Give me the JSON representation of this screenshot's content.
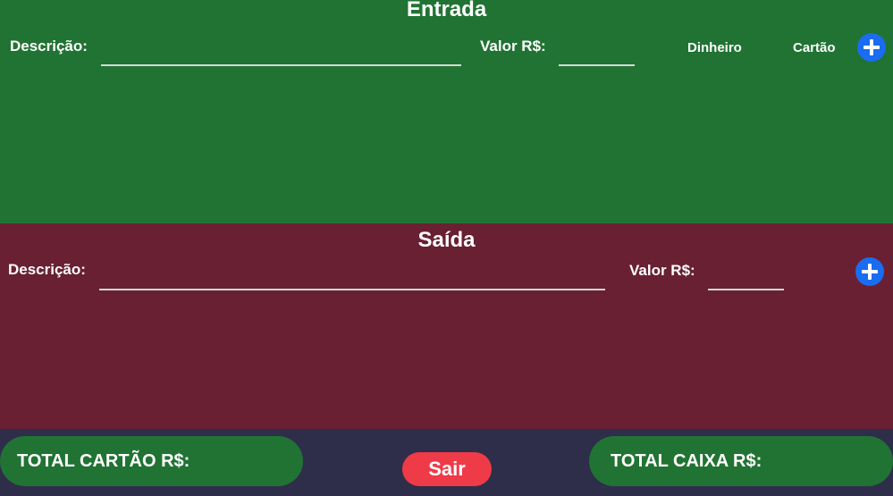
{
  "entrada": {
    "title": "Entrada",
    "description_label": "Descrição:",
    "description_value": "",
    "value_label": "Valor R$:",
    "value_value": "",
    "payment_options": [
      "Dinheiro",
      "Cartão"
    ],
    "add_icon": "plus-icon"
  },
  "saida": {
    "title": "Saída",
    "description_label": "Descrição:",
    "description_value": "",
    "value_label": "Valor R$:",
    "value_value": "",
    "add_icon": "plus-icon"
  },
  "footer": {
    "total_card_label": "TOTAL CARTÃO R$:",
    "exit_label": "Sair",
    "total_cash_label": "TOTAL CAIXA R$:"
  },
  "colors": {
    "entrada_bg": "#217333",
    "saida_bg": "#692032",
    "footer_bg": "#2e2e4a",
    "add_button": "#1a6cf0",
    "exit_button": "#ef3a48"
  }
}
